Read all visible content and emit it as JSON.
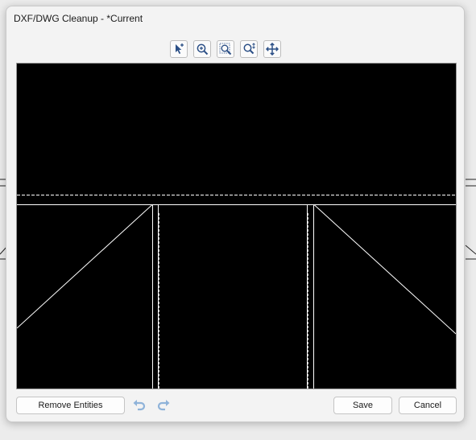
{
  "dialog": {
    "title": "DXF/DWG Cleanup - *Current"
  },
  "toolbar": {
    "tools": [
      {
        "icon": "select-entities-icon"
      },
      {
        "icon": "zoom-in-icon"
      },
      {
        "icon": "zoom-window-icon"
      },
      {
        "icon": "zoom-dynamic-icon"
      },
      {
        "icon": "pan-icon"
      }
    ]
  },
  "buttons": {
    "remove_entities": "Remove Entities",
    "save": "Save",
    "cancel": "Cancel"
  },
  "colors": {
    "viewport_background": "#000000",
    "entity_color": "#ffffff",
    "tool_icon_accent": "#2b4f86",
    "undo_redo_disabled": "#8fb3d9"
  }
}
